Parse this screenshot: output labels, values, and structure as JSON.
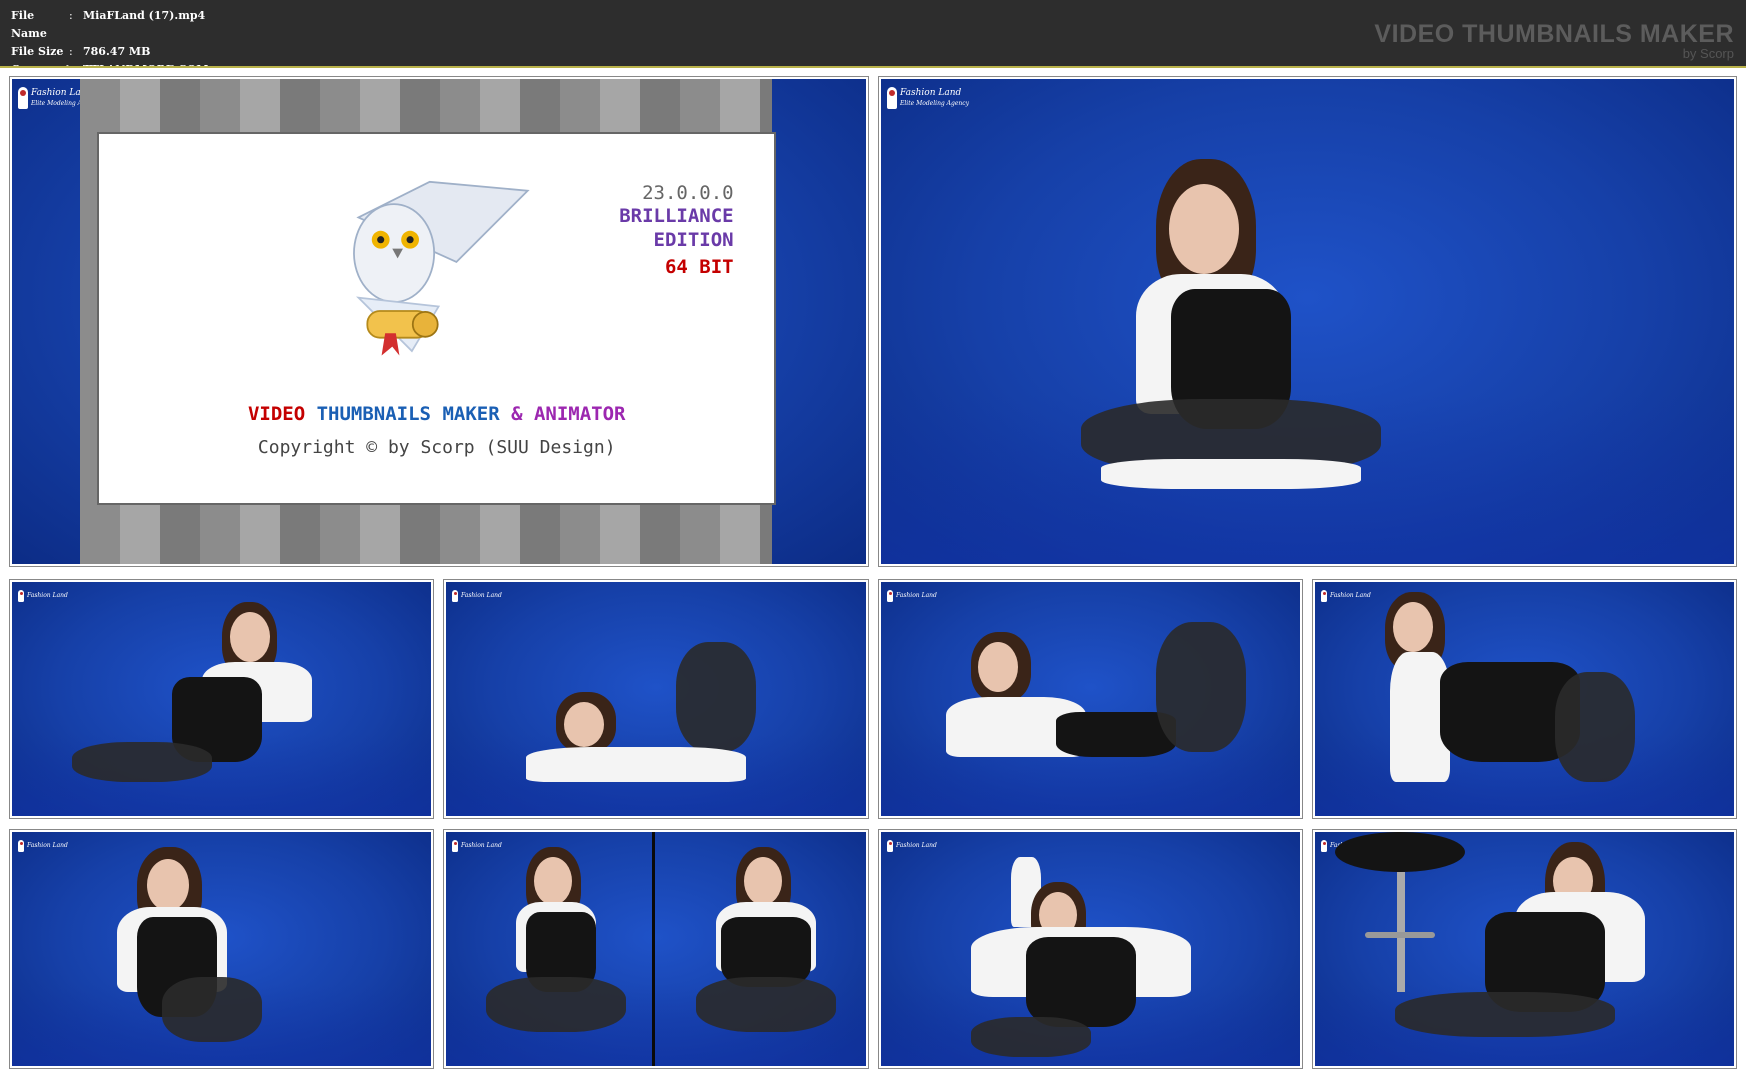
{
  "header": {
    "file_name_label": "File Name",
    "file_name_value": "MiaFLand (17).mp4",
    "file_size_label": "File Size",
    "file_size_value": "786.47 MB",
    "comment_label": "Comment",
    "comment_value": "TTLANDMORE.COM",
    "separator": ":",
    "brand_title": "VIDEO THUMBNAILS MAKER",
    "brand_sub": "by Scorp"
  },
  "splash": {
    "version": "23.0.0.0",
    "edition_line1": "BRILLIANCE",
    "edition_line2": "EDITION",
    "bits": "64 BIT",
    "title_part1": "VIDEO",
    "title_part2": "THUMBNAILS MAKER",
    "title_part3": "& ANIMATOR",
    "copyright": "Copyright © by Scorp (SUU Design)"
  },
  "watermark": {
    "line1": "Fashion Land",
    "line2": "Elite Modeling Agency"
  },
  "colors": {
    "backdrop_blue": "#1640a8",
    "header_bg": "#2d2d2d",
    "accent_border": "#b9b24a"
  },
  "thumbnails": [
    {
      "pose": "sitting-cross-legged"
    },
    {
      "pose": "reclining-on-side"
    },
    {
      "pose": "lying-prone-feet-up"
    },
    {
      "pose": "lying-prone-feet-up"
    },
    {
      "pose": "kneeling-on-all-fours"
    },
    {
      "pose": "sitting-leaning-back"
    },
    {
      "pose": "sitting-on-stool"
    },
    {
      "pose": "sitting-arm-raised"
    },
    {
      "pose": "sitting-beside-stool"
    }
  ]
}
